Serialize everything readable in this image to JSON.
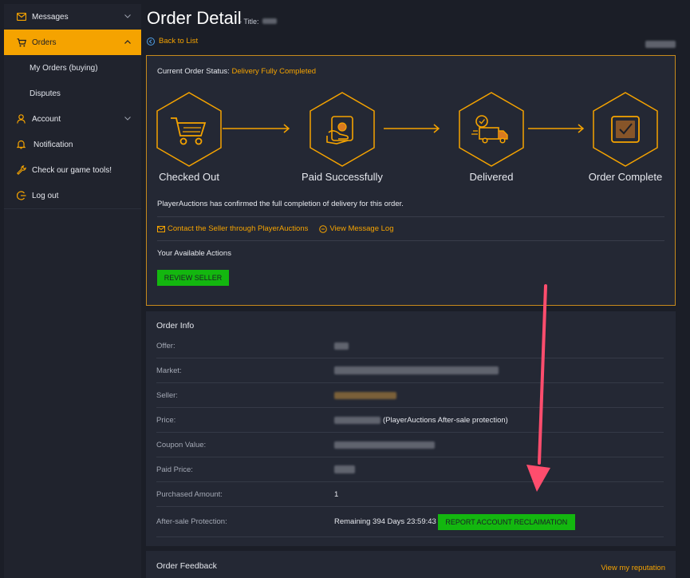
{
  "sidebar": {
    "items": [
      {
        "label": "Messages",
        "icon": "envelope-icon"
      },
      {
        "label": "Orders",
        "icon": "cart-icon"
      },
      {
        "label": "My Orders (buying)"
      },
      {
        "label": "Disputes"
      },
      {
        "label": "Account",
        "icon": "user-icon"
      },
      {
        "label": "Notification",
        "icon": "bell-icon"
      },
      {
        "label": "Check our game tools!",
        "icon": "wrench-icon"
      },
      {
        "label": "Log out",
        "icon": "logout-icon"
      }
    ]
  },
  "header": {
    "title": "Order Detail",
    "title_label": "- Title:",
    "back": "Back to List"
  },
  "status": {
    "label": "Current Order Status:",
    "value": "Delivery Fully Completed",
    "steps": [
      "Checked Out",
      "Paid Successfully",
      "Delivered",
      "Order Complete"
    ],
    "confirm": "PlayerAuctions has confirmed the full completion of delivery for this order.",
    "contact_link": "Contact the Seller through PlayerAuctions",
    "message_log_link": "View Message Log",
    "actions_label": "Your Available Actions",
    "review_button": "REVIEW SELLER"
  },
  "order_info": {
    "title": "Order Info",
    "rows": [
      {
        "key": "Offer:"
      },
      {
        "key": "Market:"
      },
      {
        "key": "Seller:"
      },
      {
        "key": "Price:",
        "suffix": "(PlayerAuctions After-sale protection)"
      },
      {
        "key": "Coupon Value:"
      },
      {
        "key": "Paid Price:"
      },
      {
        "key": "Purchased Amount:",
        "value": "1"
      },
      {
        "key": "After-sale Protection:",
        "value": "Remaining 394 Days 23:59:43"
      }
    ],
    "report_button": "REPORT ACCOUNT RECLAIMATION"
  },
  "feedback": {
    "title": "Order Feedback",
    "link": "View my reputation"
  },
  "colors": {
    "accent": "#f5a300",
    "green": "#13b70f",
    "annotation": "#ff4d6d"
  }
}
